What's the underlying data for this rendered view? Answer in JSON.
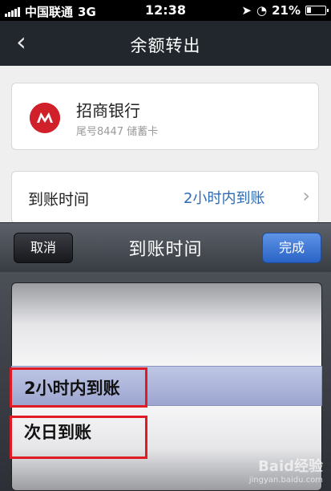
{
  "status_bar": {
    "carrier": "中国联通",
    "network": "3G",
    "time": "12:38",
    "battery": "21%"
  },
  "nav": {
    "title": "余额转出"
  },
  "bank": {
    "name": "招商银行",
    "detail": "尾号8447 储蓄卡",
    "logo_color": "#d0202a"
  },
  "arrival_row": {
    "label": "到账时间",
    "value": "2小时内到账"
  },
  "picker": {
    "cancel_label": "取消",
    "title": "到账时间",
    "done_label": "完成",
    "options": [
      "2小时内到账",
      "次日到账"
    ],
    "selected": "2小时内到账"
  },
  "watermark": {
    "main": "Baid经验",
    "sub": "jingyan.baidu.com"
  },
  "colors": {
    "nav_bg": "#22272d",
    "link": "#2e6ab4",
    "done_bg": "#2a63c6",
    "highlight": "#e01b24"
  }
}
